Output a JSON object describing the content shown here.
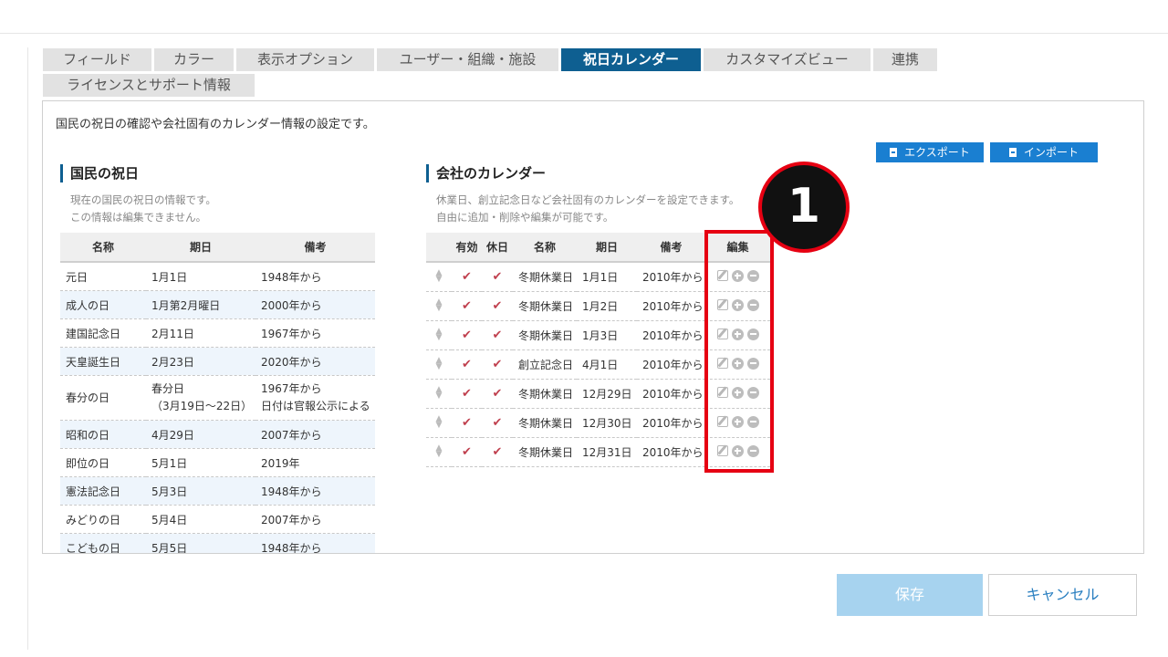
{
  "tabs": [
    {
      "label": "フィールド"
    },
    {
      "label": "カラー"
    },
    {
      "label": "表示オプション"
    },
    {
      "label": "ユーザー・組織・施設"
    },
    {
      "label": "祝日カレンダー"
    },
    {
      "label": "カスタマイズビュー"
    },
    {
      "label": "連携"
    },
    {
      "label": "ライセンスとサポート情報"
    }
  ],
  "panel": {
    "description": "国民の祝日の確認や会社固有のカレンダー情報の設定です。",
    "export_label": "エクスポート",
    "import_label": "インポート"
  },
  "national": {
    "title": "国民の祝日",
    "desc1": "現在の国民の祝日の情報です。",
    "desc2": "この情報は編集できません。",
    "headers": [
      "名称",
      "期日",
      "備考"
    ],
    "rows": [
      {
        "name": "元日",
        "date": "1月1日",
        "note": "1948年から"
      },
      {
        "name": "成人の日",
        "date": "1月第2月曜日",
        "note": "2000年から"
      },
      {
        "name": "建国記念日",
        "date": "2月11日",
        "note": "1967年から"
      },
      {
        "name": "天皇誕生日",
        "date": "2月23日",
        "note": "2020年から"
      },
      {
        "name": "春分の日",
        "date": "春分日",
        "date2": "（3月19日～22日）",
        "note": "1967年から",
        "note2": "日付は官報公示による"
      },
      {
        "name": "昭和の日",
        "date": "4月29日",
        "note": "2007年から"
      },
      {
        "name": "即位の日",
        "date": "5月1日",
        "note": "2019年"
      },
      {
        "name": "憲法記念日",
        "date": "5月3日",
        "note": "1948年から"
      },
      {
        "name": "みどりの日",
        "date": "5月4日",
        "note": "2007年から"
      },
      {
        "name": "こどもの日",
        "date": "5月5日",
        "note": "1948年から"
      }
    ]
  },
  "company": {
    "title": "会社のカレンダー",
    "desc1": "休業日、創立記念日など会社固有のカレンダーを設定できます。",
    "desc2": "自由に追加・削除や編集が可能です。",
    "headers": [
      "",
      "有効",
      "休日",
      "名称",
      "期日",
      "備考",
      "編集"
    ],
    "rows": [
      {
        "name": "冬期休業日",
        "date": "1月1日",
        "note": "2010年から"
      },
      {
        "name": "冬期休業日",
        "date": "1月2日",
        "note": "2010年から"
      },
      {
        "name": "冬期休業日",
        "date": "1月3日",
        "note": "2010年から"
      },
      {
        "name": "創立記念日",
        "date": "4月1日",
        "note": "2010年から"
      },
      {
        "name": "冬期休業日",
        "date": "12月29日",
        "note": "2010年から"
      },
      {
        "name": "冬期休業日",
        "date": "12月30日",
        "note": "2010年から"
      },
      {
        "name": "冬期休業日",
        "date": "12月31日",
        "note": "2010年から"
      }
    ]
  },
  "annotation": {
    "number": "1",
    "highlight_color": "#e60012"
  },
  "footer": {
    "save_label": "保存",
    "cancel_label": "キャンセル"
  },
  "colors": {
    "accent": "#0e5f91",
    "button": "#1a7fd1",
    "check": "#c0404e"
  }
}
